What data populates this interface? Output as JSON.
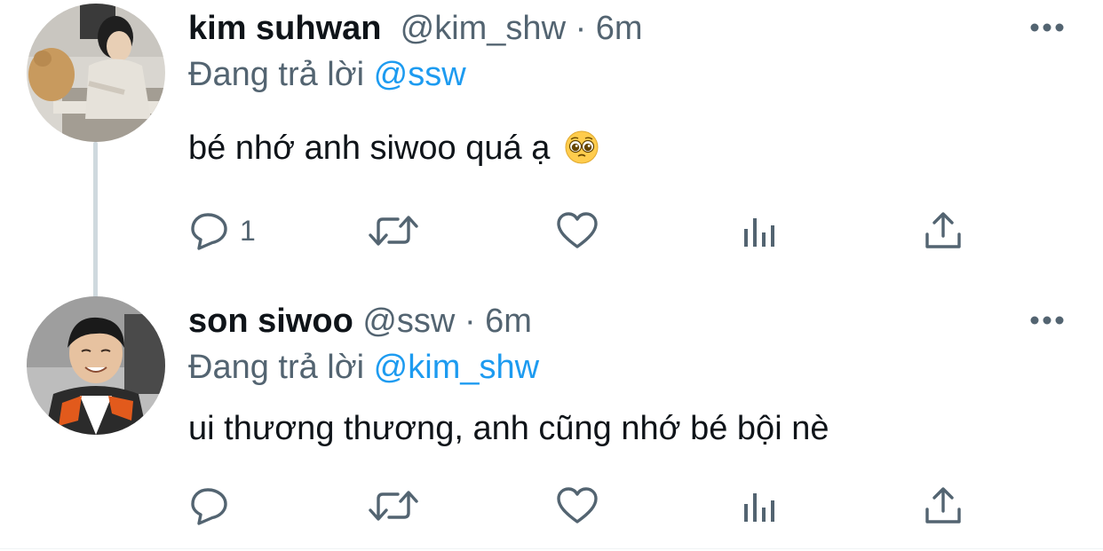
{
  "tweets": [
    {
      "name": "kim suhwan",
      "handle": "@kim_shw",
      "dot": "·",
      "time": "6m",
      "reply_prefix": "Đang trả lời",
      "reply_to": "@ssw",
      "text": "bé nhớ anh siwoo quá ạ",
      "text_emoji": "pleading-face-emoji",
      "reply_count": "1",
      "avatar": "avatar-photo-cat"
    },
    {
      "name": "son siwoo",
      "handle": "@ssw",
      "dot": "·",
      "time": "6m",
      "reply_prefix": "Đang trả lời",
      "reply_to": "@kim_shw",
      "text": "ui thương thương, anh cũng nhớ bé bội nè",
      "reply_count": "",
      "avatar": "avatar-photo-smiling"
    }
  ],
  "icons": {
    "reply": "reply-icon",
    "retweet": "retweet-icon",
    "like": "like-icon",
    "analytics": "analytics-icon",
    "share": "share-icon",
    "more": "more-icon"
  },
  "colors": {
    "text": "#0f1419",
    "secondary": "#536471",
    "link": "#1d9bf0",
    "thread_line": "#cfd9de"
  }
}
